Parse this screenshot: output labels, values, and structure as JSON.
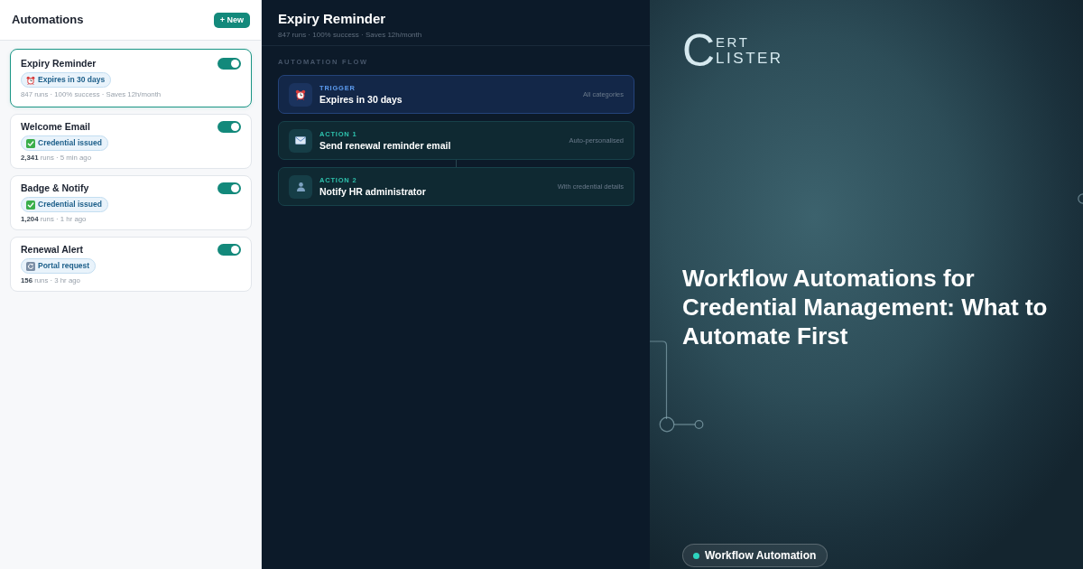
{
  "sidebar": {
    "title": "Automations",
    "new_button": "+ New",
    "automations": [
      {
        "name": "Expiry Reminder",
        "on": true,
        "selected": true,
        "tag": {
          "kind": "schedule",
          "label": "Expires in 30 days"
        },
        "meta": "847 runs · 100% success · Saves 12h/month"
      },
      {
        "name": "Welcome Email",
        "on": true,
        "selected": false,
        "tag": {
          "kind": "event",
          "label": "Credential issued"
        },
        "meta": "**2,341** runs · 5 min ago"
      },
      {
        "name": "Badge & Notify",
        "on": true,
        "selected": false,
        "tag": {
          "kind": "event",
          "label": "Credential issued"
        },
        "meta": "**1,204** runs · 1 hr ago"
      },
      {
        "name": "Renewal Alert",
        "on": true,
        "selected": false,
        "tag": {
          "kind": "request",
          "label": "Portal request"
        },
        "meta": "**156** runs · 3 hr ago"
      }
    ]
  },
  "detail": {
    "title": "Expiry Reminder",
    "meta": "847 runs · 100% success · Saves 12h/month",
    "section_label": "AUTOMATION FLOW",
    "steps": [
      {
        "kind": "trigger",
        "label": "TRIGGER",
        "title": "Expires in 30 days",
        "note": "All categories"
      },
      {
        "kind": "email",
        "label": "ACTION 1",
        "title": "Send renewal reminder email",
        "note": "Auto-personalised"
      },
      {
        "kind": "notify",
        "label": "ACTION 2",
        "title": "Notify HR administrator",
        "note": "With credential details"
      }
    ]
  },
  "hero": {
    "logo": {
      "initial": "C",
      "line_1": "ERT",
      "line_2": "LISTER"
    },
    "title": "Workflow Automations for Credential Management: What to Automate First",
    "badge": "Workflow Automation"
  }
}
